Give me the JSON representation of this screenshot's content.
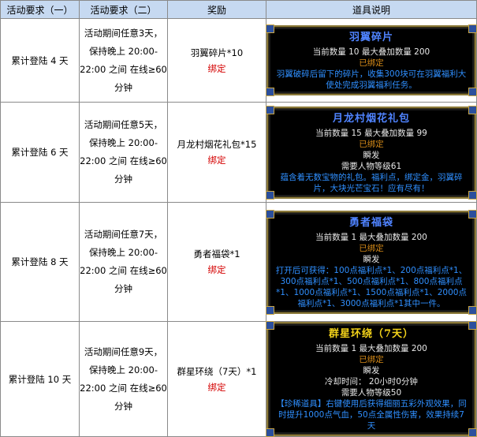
{
  "headers": [
    "活动要求（一）",
    "活动要求（二）",
    "奖励",
    "道具说明"
  ],
  "rows": [
    {
      "req1": "累计登陆 4 天",
      "req2": [
        "活动期间任意3天，",
        "保持晚上",
        "20:00-22:00 之间",
        "在线≥60 分钟"
      ],
      "reward": "羽翼碎片*10",
      "bound": "绑定",
      "item": {
        "title": "羽翼碎片",
        "qty": "当前数量 10 最大叠加数量 200",
        "status": "已绑定",
        "extra": [],
        "desc": "羽翼破碎后留下的碎片，收集300块可在羽翼福利大使处完成羽翼福利任务。"
      }
    },
    {
      "req1": "累计登陆 6 天",
      "req2": [
        "活动期间任意5天，",
        "保持晚上",
        "20:00-22:00 之间",
        "在线≥60 分钟"
      ],
      "reward": "月龙村烟花礼包*15",
      "bound": "绑定",
      "item": {
        "title": "月龙村烟花礼包",
        "qty": "当前数量 15 最大叠加数量 99",
        "status": "已绑定",
        "extra": [
          "瞬发",
          "需要人物等级61"
        ],
        "desc": "蕴含着无数宝物的礼包。福利点，绑定金，羽翼碎片，大块光芒宝石！应有尽有！"
      }
    },
    {
      "req1": "累计登陆 8 天",
      "req2": [
        "活动期间任意7天，",
        "保持晚上",
        "20:00-22:00 之间",
        "在线≥60 分钟"
      ],
      "reward": "勇者福袋*1",
      "bound": "绑定",
      "item": {
        "title": "勇者福袋",
        "qty": "当前数量 1 最大叠加数量 200",
        "status": "已绑定",
        "extra": [
          "瞬发"
        ],
        "desc": "打开后可获得：100点福利点*1、200点福利点*1、300点福利点*1、500点福利点*1、800点福利点*1、1000点福利点*1、1500点福利点*1、2000点福利点*1、3000点福利点*1其中一件。"
      }
    },
    {
      "req1": "累计登陆 10 天",
      "req2": [
        "活动期间任意9天，",
        "保持晚上",
        "20:00-22:00 之间",
        "在线≥60 分钟"
      ],
      "reward": "群星环绕（7天）*1",
      "bound": "绑定",
      "item": {
        "title": "群星环绕（7天）",
        "qty": "当前数量 1 最大叠加数量 200",
        "status": "已绑定",
        "extra": [
          "瞬发",
          "冷却时间： 20小时0分钟",
          "需要人物等级50"
        ],
        "desc": "【珍稀道具】右键使用后获得细丽五彩外观效果，同时提升1000点气血，50点全属性伤害，效果持续7天"
      }
    }
  ],
  "colors": {
    "header_bg": "#c6d9f1",
    "bound": "#d40000",
    "title_blue": "#4f83ff",
    "title_gold": "#f2d21a",
    "status_orange": "#d58a18",
    "desc_green": "#39d14a",
    "desc_blue": "#2f8fff"
  }
}
